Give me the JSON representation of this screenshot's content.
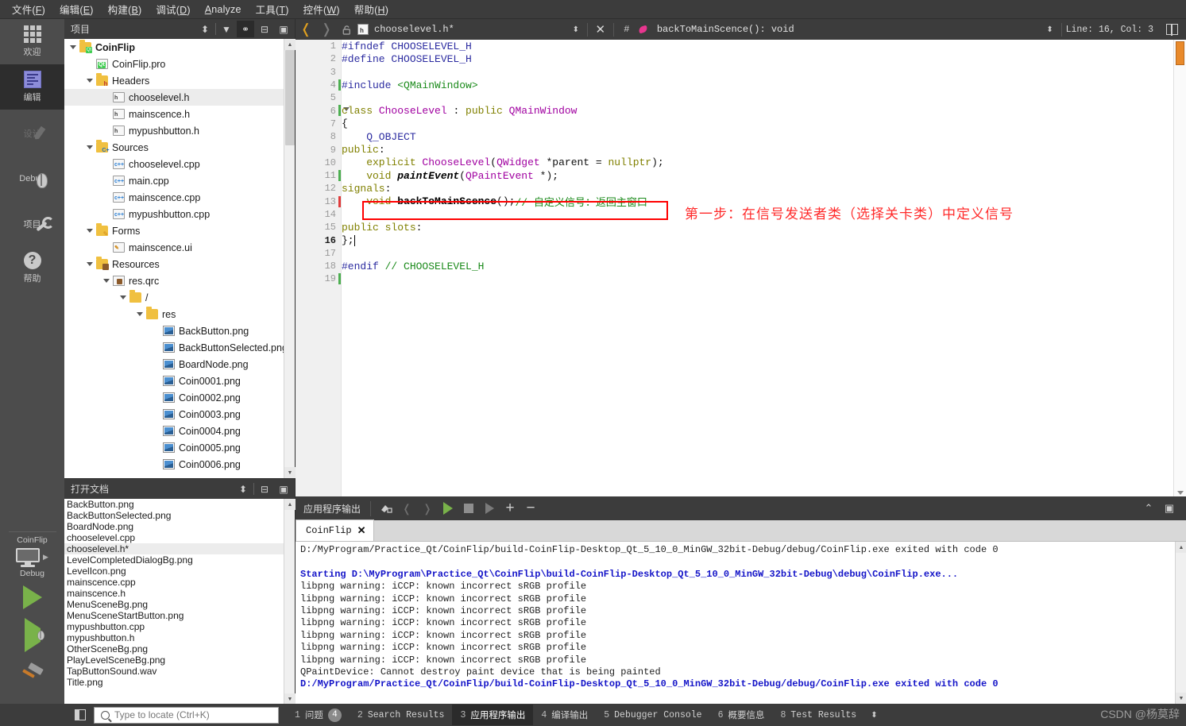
{
  "menubar": {
    "items": [
      {
        "label": "文件(F)",
        "accel": "F"
      },
      {
        "label": "编辑(E)",
        "accel": "E"
      },
      {
        "label": "构建(B)",
        "accel": "B"
      },
      {
        "label": "调试(D)",
        "accel": "D"
      },
      {
        "label": "Analyze",
        "accel": "A"
      },
      {
        "label": "工具(T)",
        "accel": "T"
      },
      {
        "label": "控件(W)",
        "accel": "W"
      },
      {
        "label": "帮助(H)",
        "accel": "H"
      }
    ]
  },
  "modebar": {
    "modes": [
      {
        "label": "欢迎",
        "icon": "grid-icon",
        "state": "normal"
      },
      {
        "label": "编辑",
        "icon": "edit-icon",
        "state": "active"
      },
      {
        "label": "设计",
        "icon": "design-pencil-icon",
        "state": "disabled"
      },
      {
        "label": "Debug",
        "icon": "bug-icon",
        "state": "normal"
      },
      {
        "label": "项目",
        "icon": "wrench-icon",
        "state": "normal"
      },
      {
        "label": "帮助",
        "icon": "question-icon",
        "state": "normal"
      }
    ],
    "kit": {
      "project": "CoinFlip",
      "buildconfig": "Debug",
      "run_icon": "run-triangle-icon",
      "debug_icon": "run-debug-icon",
      "build_icon": "hammer-icon"
    }
  },
  "project_panel": {
    "title": "项目",
    "toolbar": [
      {
        "name": "sync-selector",
        "glyph": "⬍"
      },
      {
        "name": "filter-icon",
        "glyph": "▼"
      },
      {
        "name": "link-icon",
        "glyph": "⚭"
      },
      {
        "name": "split-add-icon",
        "glyph": "⊟+"
      },
      {
        "name": "close-split-icon",
        "glyph": "▣"
      }
    ],
    "tree": [
      {
        "depth": 0,
        "label": "CoinFlip",
        "icon": "folder-qt",
        "arrow": "down",
        "bold": true,
        "selected": false
      },
      {
        "depth": 1,
        "label": "CoinFlip.pro",
        "icon": "doc-qt",
        "arrow": "none",
        "bold": false,
        "selected": false
      },
      {
        "depth": 1,
        "label": "Headers",
        "icon": "folder-h",
        "arrow": "down",
        "bold": false,
        "selected": false
      },
      {
        "depth": 2,
        "label": "chooselevel.h",
        "icon": "doc-h",
        "arrow": "none",
        "bold": false,
        "selected": true
      },
      {
        "depth": 2,
        "label": "mainscence.h",
        "icon": "doc-h",
        "arrow": "none",
        "bold": false,
        "selected": false
      },
      {
        "depth": 2,
        "label": "mypushbutton.h",
        "icon": "doc-h",
        "arrow": "none",
        "bold": false,
        "selected": false
      },
      {
        "depth": 1,
        "label": "Sources",
        "icon": "folder-cpp",
        "arrow": "down",
        "bold": false,
        "selected": false
      },
      {
        "depth": 2,
        "label": "chooselevel.cpp",
        "icon": "doc-cpp",
        "arrow": "none",
        "bold": false,
        "selected": false
      },
      {
        "depth": 2,
        "label": "main.cpp",
        "icon": "doc-cpp",
        "arrow": "none",
        "bold": false,
        "selected": false
      },
      {
        "depth": 2,
        "label": "mainscence.cpp",
        "icon": "doc-cpp",
        "arrow": "none",
        "bold": false,
        "selected": false
      },
      {
        "depth": 2,
        "label": "mypushbutton.cpp",
        "icon": "doc-cpp",
        "arrow": "none",
        "bold": false,
        "selected": false
      },
      {
        "depth": 1,
        "label": "Forms",
        "icon": "folder-ui",
        "arrow": "down",
        "bold": false,
        "selected": false
      },
      {
        "depth": 2,
        "label": "mainscence.ui",
        "icon": "doc-ui",
        "arrow": "none",
        "bold": false,
        "selected": false
      },
      {
        "depth": 1,
        "label": "Resources",
        "icon": "folder-qrc",
        "arrow": "down",
        "bold": false,
        "selected": false
      },
      {
        "depth": 2,
        "label": "res.qrc",
        "icon": "doc-qrc",
        "arrow": "down",
        "bold": false,
        "selected": false
      },
      {
        "depth": 3,
        "label": "/",
        "icon": "folder-plain",
        "arrow": "down",
        "bold": false,
        "selected": false
      },
      {
        "depth": 4,
        "label": "res",
        "icon": "folder-plain",
        "arrow": "down",
        "bold": false,
        "selected": false
      },
      {
        "depth": 5,
        "label": "BackButton.png",
        "icon": "doc-img",
        "arrow": "none",
        "bold": false,
        "selected": false
      },
      {
        "depth": 5,
        "label": "BackButtonSelected.png",
        "icon": "doc-img",
        "arrow": "none",
        "bold": false,
        "selected": false
      },
      {
        "depth": 5,
        "label": "BoardNode.png",
        "icon": "doc-img",
        "arrow": "none",
        "bold": false,
        "selected": false
      },
      {
        "depth": 5,
        "label": "Coin0001.png",
        "icon": "doc-img",
        "arrow": "none",
        "bold": false,
        "selected": false
      },
      {
        "depth": 5,
        "label": "Coin0002.png",
        "icon": "doc-img",
        "arrow": "none",
        "bold": false,
        "selected": false
      },
      {
        "depth": 5,
        "label": "Coin0003.png",
        "icon": "doc-img",
        "arrow": "none",
        "bold": false,
        "selected": false
      },
      {
        "depth": 5,
        "label": "Coin0004.png",
        "icon": "doc-img",
        "arrow": "none",
        "bold": false,
        "selected": false
      },
      {
        "depth": 5,
        "label": "Coin0005.png",
        "icon": "doc-img",
        "arrow": "none",
        "bold": false,
        "selected": false
      },
      {
        "depth": 5,
        "label": "Coin0006.png",
        "icon": "doc-img",
        "arrow": "none",
        "bold": false,
        "selected": false
      }
    ]
  },
  "open_documents": {
    "title": "打开文档",
    "toolbar": [
      {
        "name": "sort-selector",
        "glyph": "⬍"
      },
      {
        "name": "split-add-icon",
        "glyph": "⊟+"
      },
      {
        "name": "close-split-icon",
        "glyph": "▣"
      }
    ],
    "items": [
      {
        "label": "BackButton.png",
        "selected": false
      },
      {
        "label": "BackButtonSelected.png",
        "selected": false
      },
      {
        "label": "BoardNode.png",
        "selected": false
      },
      {
        "label": "chooselevel.cpp",
        "selected": false
      },
      {
        "label": "chooselevel.h*",
        "selected": true
      },
      {
        "label": "LevelCompletedDialogBg.png",
        "selected": false
      },
      {
        "label": "LevelIcon.png",
        "selected": false
      },
      {
        "label": "mainscence.cpp",
        "selected": false
      },
      {
        "label": "mainscence.h",
        "selected": false
      },
      {
        "label": "MenuSceneBg.png",
        "selected": false
      },
      {
        "label": "MenuSceneStartButton.png",
        "selected": false
      },
      {
        "label": "mypushbutton.cpp",
        "selected": false
      },
      {
        "label": "mypushbutton.h",
        "selected": false
      },
      {
        "label": "OtherSceneBg.png",
        "selected": false
      },
      {
        "label": "PlayLevelSceneBg.png",
        "selected": false
      },
      {
        "label": "TapButtonSound.wav",
        "selected": false
      },
      {
        "label": "Title.png",
        "selected": false
      }
    ]
  },
  "editor_toolbar": {
    "back_glyph": "❬",
    "forward_glyph": "❭",
    "lock_glyph": "🔓",
    "filename": "chooselevel.h*",
    "file_selector_glyph": "⬍",
    "close_glyph": "✕",
    "hash_glyph": "#",
    "symbol": "backToMainScence(): void",
    "symbol_selector_glyph": "⬍",
    "line_col": "Line: 16, Col: 3",
    "split_glyph": "split-editor-icon"
  },
  "code": {
    "lines": [
      {
        "n": "1",
        "mark": "",
        "fold": false,
        "tokens": [
          {
            "t": "#ifndef ",
            "c": "pp"
          },
          {
            "t": "CHOOSELEVEL_H",
            "c": "pp"
          }
        ]
      },
      {
        "n": "2",
        "mark": "",
        "fold": false,
        "tokens": [
          {
            "t": "#define ",
            "c": "pp"
          },
          {
            "t": "CHOOSELEVEL_H",
            "c": "pp"
          }
        ]
      },
      {
        "n": "3",
        "mark": "",
        "fold": false,
        "tokens": []
      },
      {
        "n": "4",
        "mark": "green",
        "fold": false,
        "tokens": [
          {
            "t": "#include ",
            "c": "pp"
          },
          {
            "t": "<QMainWindow>",
            "c": "str"
          }
        ]
      },
      {
        "n": "5",
        "mark": "",
        "fold": false,
        "tokens": []
      },
      {
        "n": "6",
        "mark": "green",
        "fold": true,
        "tokens": [
          {
            "t": "class ",
            "c": "kw"
          },
          {
            "t": "ChooseLevel",
            "c": "type"
          },
          {
            "t": " : ",
            "c": "plain"
          },
          {
            "t": "public ",
            "c": "kw"
          },
          {
            "t": "QMainWindow",
            "c": "type"
          }
        ]
      },
      {
        "n": "7",
        "mark": "",
        "fold": false,
        "tokens": [
          {
            "t": "{",
            "c": "plain"
          }
        ]
      },
      {
        "n": "8",
        "mark": "",
        "fold": false,
        "tokens": [
          {
            "t": "    Q_OBJECT",
            "c": "pp"
          }
        ]
      },
      {
        "n": "9",
        "mark": "",
        "fold": false,
        "tokens": [
          {
            "t": "public",
            "c": "kw"
          },
          {
            "t": ":",
            "c": "plain"
          }
        ]
      },
      {
        "n": "10",
        "mark": "",
        "fold": false,
        "tokens": [
          {
            "t": "    explicit ",
            "c": "kw"
          },
          {
            "t": "ChooseLevel",
            "c": "type"
          },
          {
            "t": "(",
            "c": "plain"
          },
          {
            "t": "QWidget ",
            "c": "type"
          },
          {
            "t": "*parent = ",
            "c": "plain"
          },
          {
            "t": "nullptr",
            "c": "kw"
          },
          {
            "t": ");",
            "c": "plain"
          }
        ]
      },
      {
        "n": "11",
        "mark": "green",
        "fold": false,
        "tokens": [
          {
            "t": "    void ",
            "c": "kw"
          },
          {
            "t": "paintEvent",
            "c": "virt"
          },
          {
            "t": "(",
            "c": "plain"
          },
          {
            "t": "QPaintEvent ",
            "c": "type"
          },
          {
            "t": "*);",
            "c": "plain"
          }
        ]
      },
      {
        "n": "12",
        "mark": "",
        "fold": false,
        "tokens": [
          {
            "t": "signals",
            "c": "kw"
          },
          {
            "t": ":",
            "c": "plain"
          }
        ]
      },
      {
        "n": "13",
        "mark": "red",
        "fold": false,
        "tokens": [
          {
            "t": "    void ",
            "c": "kw"
          },
          {
            "t": "backToMainScence",
            "c": "fn"
          },
          {
            "t": "();",
            "c": "plain"
          },
          {
            "t": "// 自定义信号：返回主窗口",
            "c": "cmt"
          }
        ]
      },
      {
        "n": "14",
        "mark": "",
        "fold": false,
        "tokens": []
      },
      {
        "n": "15",
        "mark": "",
        "fold": false,
        "tokens": [
          {
            "t": "public slots",
            "c": "kw"
          },
          {
            "t": ":",
            "c": "plain"
          }
        ]
      },
      {
        "n": "16",
        "mark": "",
        "fold": false,
        "current": true,
        "caret": true,
        "tokens": [
          {
            "t": "};",
            "c": "plain"
          }
        ]
      },
      {
        "n": "17",
        "mark": "",
        "fold": false,
        "tokens": []
      },
      {
        "n": "18",
        "mark": "",
        "fold": false,
        "tokens": [
          {
            "t": "#endif ",
            "c": "pp"
          },
          {
            "t": "// CHOOSELEVEL_H",
            "c": "cmt"
          }
        ]
      },
      {
        "n": "19",
        "mark": "green",
        "fold": false,
        "tokens": []
      }
    ],
    "annotation": "第一步：在信号发送者类（选择关卡类）中定义信号",
    "annotation_color": "#ff2b2b",
    "highlight_box_color": "#ff0000"
  },
  "output_bar": {
    "title": "应用程序输出",
    "buttons": [
      {
        "name": "clear-output-icon",
        "glyph": "⎙"
      },
      {
        "name": "prev-item-icon",
        "glyph": "❬"
      },
      {
        "name": "next-item-icon",
        "glyph": "❭"
      },
      {
        "name": "run-icon",
        "glyph": "▶"
      },
      {
        "name": "stop-icon",
        "glyph": "■"
      },
      {
        "name": "attach-debugger-icon",
        "glyph": "▶"
      },
      {
        "name": "zoom-in-icon",
        "glyph": "+"
      },
      {
        "name": "zoom-out-icon",
        "glyph": "−"
      }
    ],
    "maximize_glyph": "⌃",
    "close_glyph": "▣",
    "tab": {
      "label": "CoinFlip",
      "close_glyph": "✕"
    }
  },
  "console": {
    "lines": [
      {
        "text": "D:/MyProgram/Practice_Qt/CoinFlip/build-CoinFlip-Desktop_Qt_5_10_0_MinGW_32bit-Debug/debug/CoinFlip.exe exited with code 0",
        "style": "normal"
      },
      {
        "text": "",
        "style": "normal"
      },
      {
        "text": "Starting D:\\MyProgram\\Practice_Qt\\CoinFlip\\build-CoinFlip-Desktop_Qt_5_10_0_MinGW_32bit-Debug\\debug\\CoinFlip.exe...",
        "style": "blue"
      },
      {
        "text": "libpng warning: iCCP: known incorrect sRGB profile",
        "style": "normal"
      },
      {
        "text": "libpng warning: iCCP: known incorrect sRGB profile",
        "style": "normal"
      },
      {
        "text": "libpng warning: iCCP: known incorrect sRGB profile",
        "style": "normal"
      },
      {
        "text": "libpng warning: iCCP: known incorrect sRGB profile",
        "style": "normal"
      },
      {
        "text": "libpng warning: iCCP: known incorrect sRGB profile",
        "style": "normal"
      },
      {
        "text": "libpng warning: iCCP: known incorrect sRGB profile",
        "style": "normal"
      },
      {
        "text": "libpng warning: iCCP: known incorrect sRGB profile",
        "style": "normal"
      },
      {
        "text": "QPaintDevice: Cannot destroy paint device that is being painted",
        "style": "normal"
      },
      {
        "text": "D:/MyProgram/Practice_Qt/CoinFlip/build-CoinFlip-Desktop_Qt_5_10_0_MinGW_32bit-Debug/debug/CoinFlip.exe exited with code 0",
        "style": "blue"
      }
    ]
  },
  "statusbar": {
    "toggle_sidebar_icon": "toggle-sidebar-icon",
    "locate_placeholder": "Type to locate (Ctrl+K)",
    "tabs": [
      {
        "num": "1",
        "label": "问题",
        "badge": "4",
        "active": false
      },
      {
        "num": "2",
        "label": "Search Results",
        "badge": "",
        "active": false
      },
      {
        "num": "3",
        "label": "应用程序输出",
        "badge": "",
        "active": true
      },
      {
        "num": "4",
        "label": "编译输出",
        "badge": "",
        "active": false
      },
      {
        "num": "5",
        "label": "Debugger Console",
        "badge": "",
        "active": false
      },
      {
        "num": "6",
        "label": "概要信息",
        "badge": "",
        "active": false
      },
      {
        "num": "8",
        "label": "Test Results",
        "badge": "",
        "active": false
      }
    ],
    "more_glyph": "⬍",
    "watermark": "CSDN @杨莫辞"
  }
}
